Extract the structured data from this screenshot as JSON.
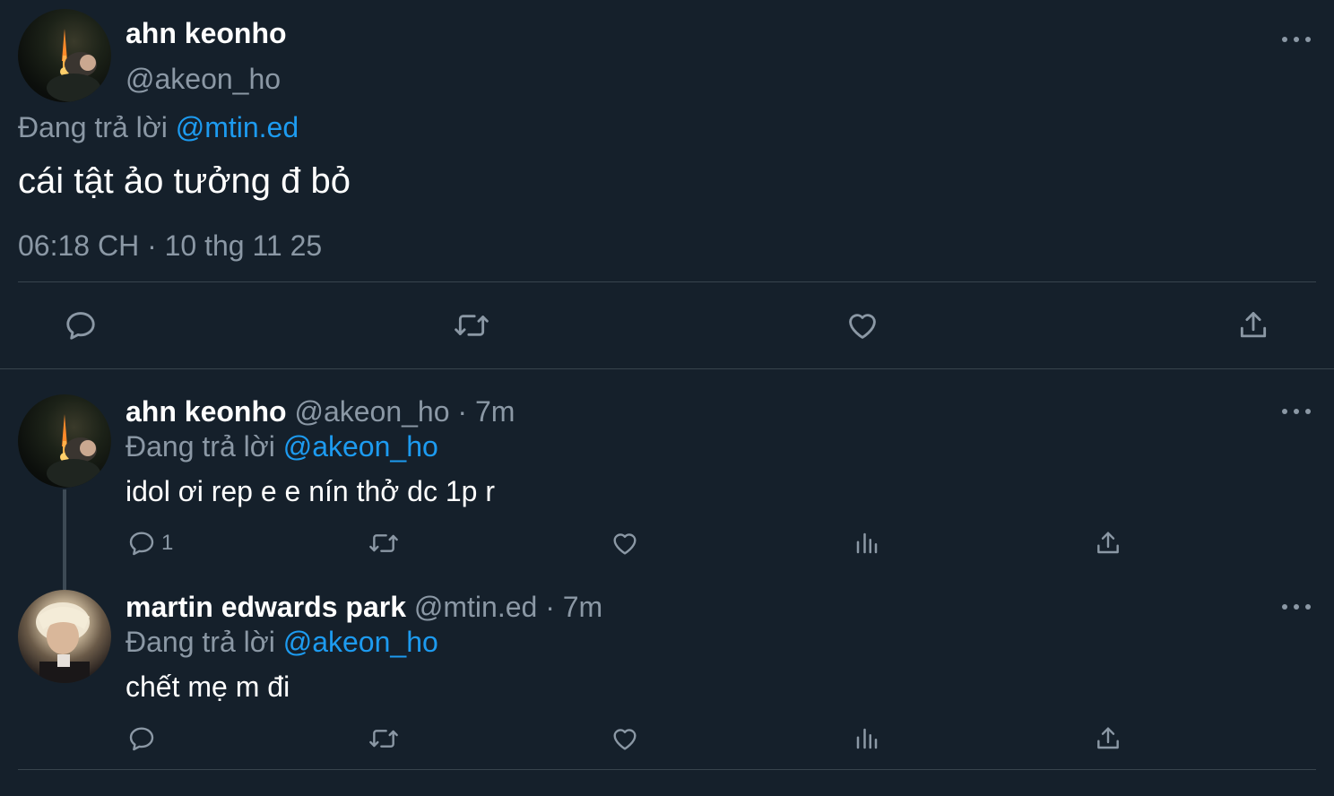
{
  "main_tweet": {
    "author_name": "ahn keonho",
    "handle": "@akeon_ho",
    "replying_prefix": "Đang trả lời",
    "replying_to": "@mtin.ed",
    "text": "cái tật ảo tưởng đ bỏ",
    "timestamp": "06:18 CH · 10 thg 11 25",
    "actions": [
      "reply",
      "retweet",
      "like",
      "share"
    ]
  },
  "replies": [
    {
      "author_name": "ahn keonho",
      "handle": "@akeon_ho",
      "time": "· 7m",
      "replying_prefix": "Đang trả lời",
      "replying_to": "@akeon_ho",
      "text": "idol ơi rep e e nín thở dc 1p r",
      "reply_count": "1"
    },
    {
      "author_name": "martin edwards park",
      "handle": "@mtin.ed",
      "time": "· 7m",
      "replying_prefix": "Đang trả lời",
      "replying_to": "@akeon_ho",
      "text": "chết mẹ m đi",
      "reply_count": ""
    }
  ],
  "icons": {
    "reply": "speech-bubble-icon",
    "retweet": "retweet-arrows-icon",
    "like": "heart-icon",
    "views": "bar-chart-icon",
    "share": "share-upload-icon",
    "more": "ellipsis-icon"
  },
  "colors": {
    "background": "#15202b",
    "text": "#ffffff",
    "muted": "#8b98a5",
    "link": "#1d9bf0",
    "divider": "#38444d"
  }
}
